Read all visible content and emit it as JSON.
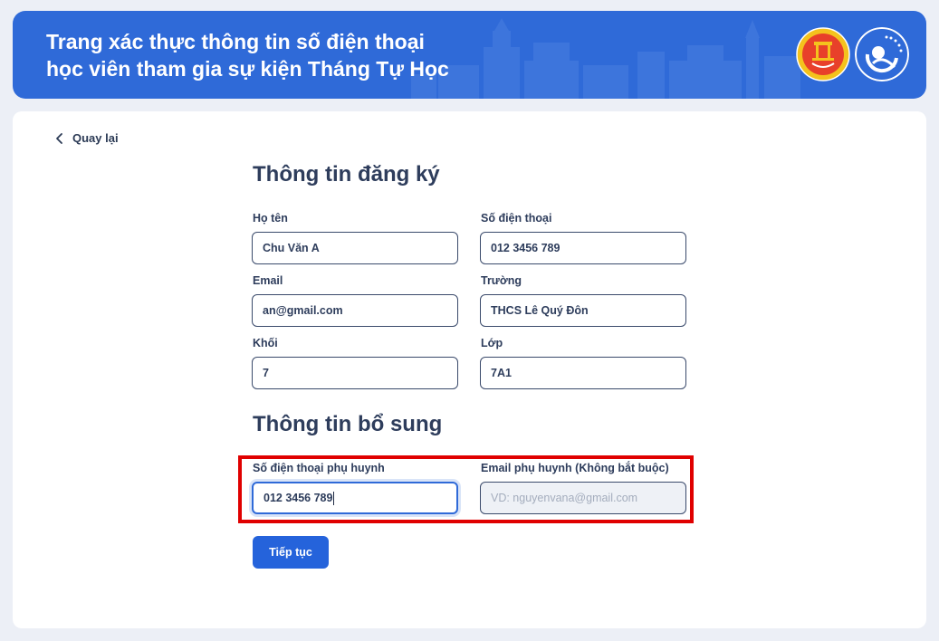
{
  "header": {
    "title_line1": "Trang xác thực thông tin số điện thoại",
    "title_line2": "học viên tham gia sự kiện Tháng Tự Học",
    "logos": [
      "hanoi-education-logo",
      "youth-union-logo"
    ],
    "background_color": "#2f6ad8"
  },
  "nav": {
    "back_label": "Quay lại"
  },
  "registration": {
    "title": "Thông tin đăng ký",
    "fields": {
      "name": {
        "label": "Họ tên",
        "value": "Chu Văn A"
      },
      "phone": {
        "label": "Số điện thoại",
        "value": "012 3456 789"
      },
      "email": {
        "label": "Email",
        "value": "an@gmail.com"
      },
      "school": {
        "label": "Trường",
        "value": "THCS Lê Quý Đôn"
      },
      "grade": {
        "label": "Khối",
        "value": "7"
      },
      "class": {
        "label": "Lớp",
        "value": "7A1"
      }
    }
  },
  "supplement": {
    "title": "Thông tin bổ sung",
    "fields": {
      "parent_phone": {
        "label": "Số điện thoại phụ huynh",
        "value": "012 3456 789"
      },
      "parent_email": {
        "label": "Email phụ huynh (Không bắt buộc)",
        "value": "",
        "placeholder": "VD: nguyenvana@gmail.com"
      }
    }
  },
  "actions": {
    "continue_label": "Tiếp tục",
    "accent_color": "#2563db"
  },
  "annotation": {
    "highlight_color": "#e00000"
  }
}
